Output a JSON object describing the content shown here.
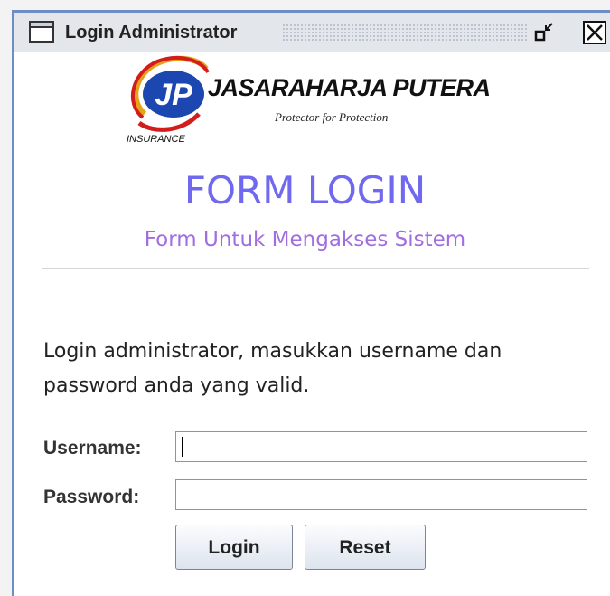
{
  "window": {
    "title": "Login Administrator",
    "icons": [
      "window-icon",
      "restore-icon",
      "close-icon"
    ]
  },
  "logo": {
    "mark": "JP",
    "brand": "JASARAHARJA PUTERA",
    "tagline": "Protector for Protection",
    "insurance": "INSURANCE"
  },
  "form": {
    "title": "FORM LOGIN",
    "subtitle": "Form Untuk Mengakses Sistem",
    "intro": "Login administrator, masukkan username dan password anda yang valid.",
    "username_label": "Username:",
    "password_label": "Password:",
    "username_value": "",
    "password_value": "",
    "login_label": "Login",
    "reset_label": "Reset"
  },
  "colors": {
    "title": "#7069f0",
    "subtitle": "#a16ee0",
    "window_border": "#6d8ec4"
  }
}
